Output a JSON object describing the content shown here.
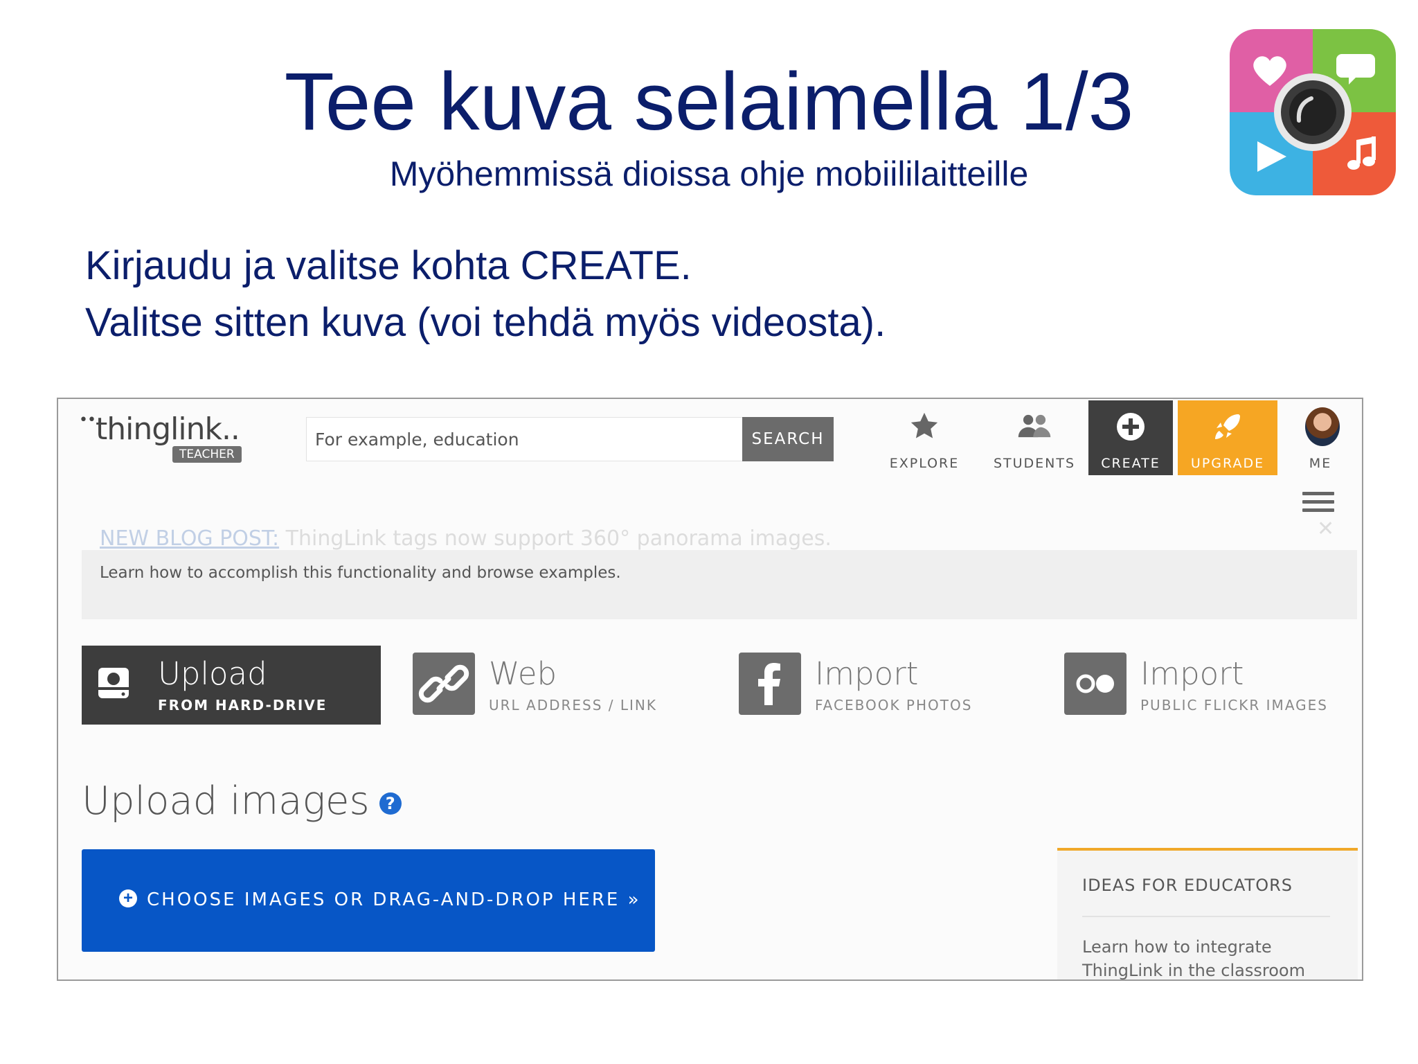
{
  "slide": {
    "title": "Tee kuva selaimella 1/3",
    "subtitle": "Myöhemmissä dioissa ohje mobiililaitteille",
    "line1": "Kirjaudu ja valitse kohta CREATE.",
    "line2": "Valitse sitten kuva (voi tehdä myös videosta)."
  },
  "app_icon": {
    "icons": [
      "heart-icon",
      "chat-bubble-icon",
      "camera-icon",
      "play-icon",
      "music-note-icon"
    ],
    "colors": {
      "pink": "#e05fa5",
      "green": "#7cc243",
      "blue": "#3db2e3",
      "red": "#ee5a3a"
    }
  },
  "thinglink": {
    "logo": "thinglink..",
    "logo_dots": "••",
    "badge": "TEACHER",
    "search": {
      "placeholder": "For example, education",
      "button": "SEARCH"
    },
    "nav": {
      "explore": "EXPLORE",
      "students": "STUDENTS",
      "create": "CREATE",
      "upgrade": "UPGRADE",
      "me": "ME"
    },
    "banner": {
      "link": "NEW BLOG POST:",
      "text": " ThingLink tags now support 360° panorama images.",
      "info": "Learn how to accomplish this functionality and browse examples."
    },
    "sources": [
      {
        "title": "Upload",
        "subtitle": "FROM HARD-DRIVE"
      },
      {
        "title": "Web",
        "subtitle": "URL ADDRESS / LINK"
      },
      {
        "title": "Import",
        "subtitle": "FACEBOOK PHOTOS"
      },
      {
        "title": "Import",
        "subtitle": "PUBLIC FLICKR IMAGES"
      }
    ],
    "upload_heading": "Upload images",
    "choose_button": "CHOOSE IMAGES OR DRAG-AND-DROP HERE »",
    "ideas": {
      "title": "IDEAS FOR EDUCATORS",
      "text": "Learn how to integrate ThingLink in the classroom"
    },
    "colors": {
      "create_bg": "#3f3f3f",
      "upgrade_bg": "#f6a623",
      "choose_bg": "#0756c6",
      "accent_rule": "#f0a82a"
    }
  }
}
